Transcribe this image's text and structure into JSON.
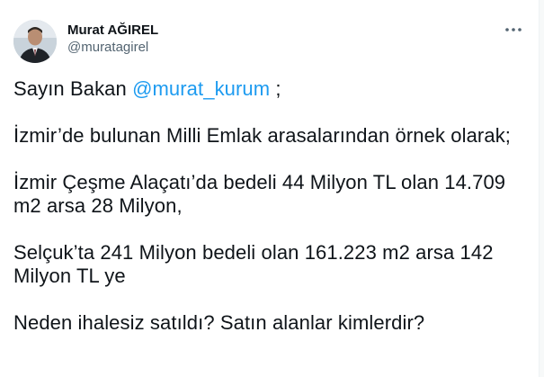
{
  "author": {
    "display_name": "Murat AĞIREL",
    "handle": "@muratagirel"
  },
  "icons": {
    "more": "more-options-icon",
    "avatar": "avatar"
  },
  "tweet": {
    "line1_prefix": "Sayın Bakan ",
    "mention": "@murat_kurum",
    "line1_suffix": " ;",
    "paragraph2": "İzmir’de bulunan Milli Emlak arasalarından örnek olarak;",
    "paragraph3_line1": "İzmir Çeşme Alaçatı’da bedeli 44 Milyon TL olan 14.709",
    "paragraph3_line2": "m2 arsa 28 Milyon,",
    "paragraph4_line1": "Selçuk’ta 241 Milyon bedeli olan 161.223 m2 arsa 142",
    "paragraph4_line2": "Milyon TL ye",
    "paragraph5": "Neden ihalesiz satıldı? Satın alanlar kimlerdir?"
  },
  "colors": {
    "link": "#1d9bf0",
    "text": "#0f1419",
    "secondary": "#536471"
  }
}
